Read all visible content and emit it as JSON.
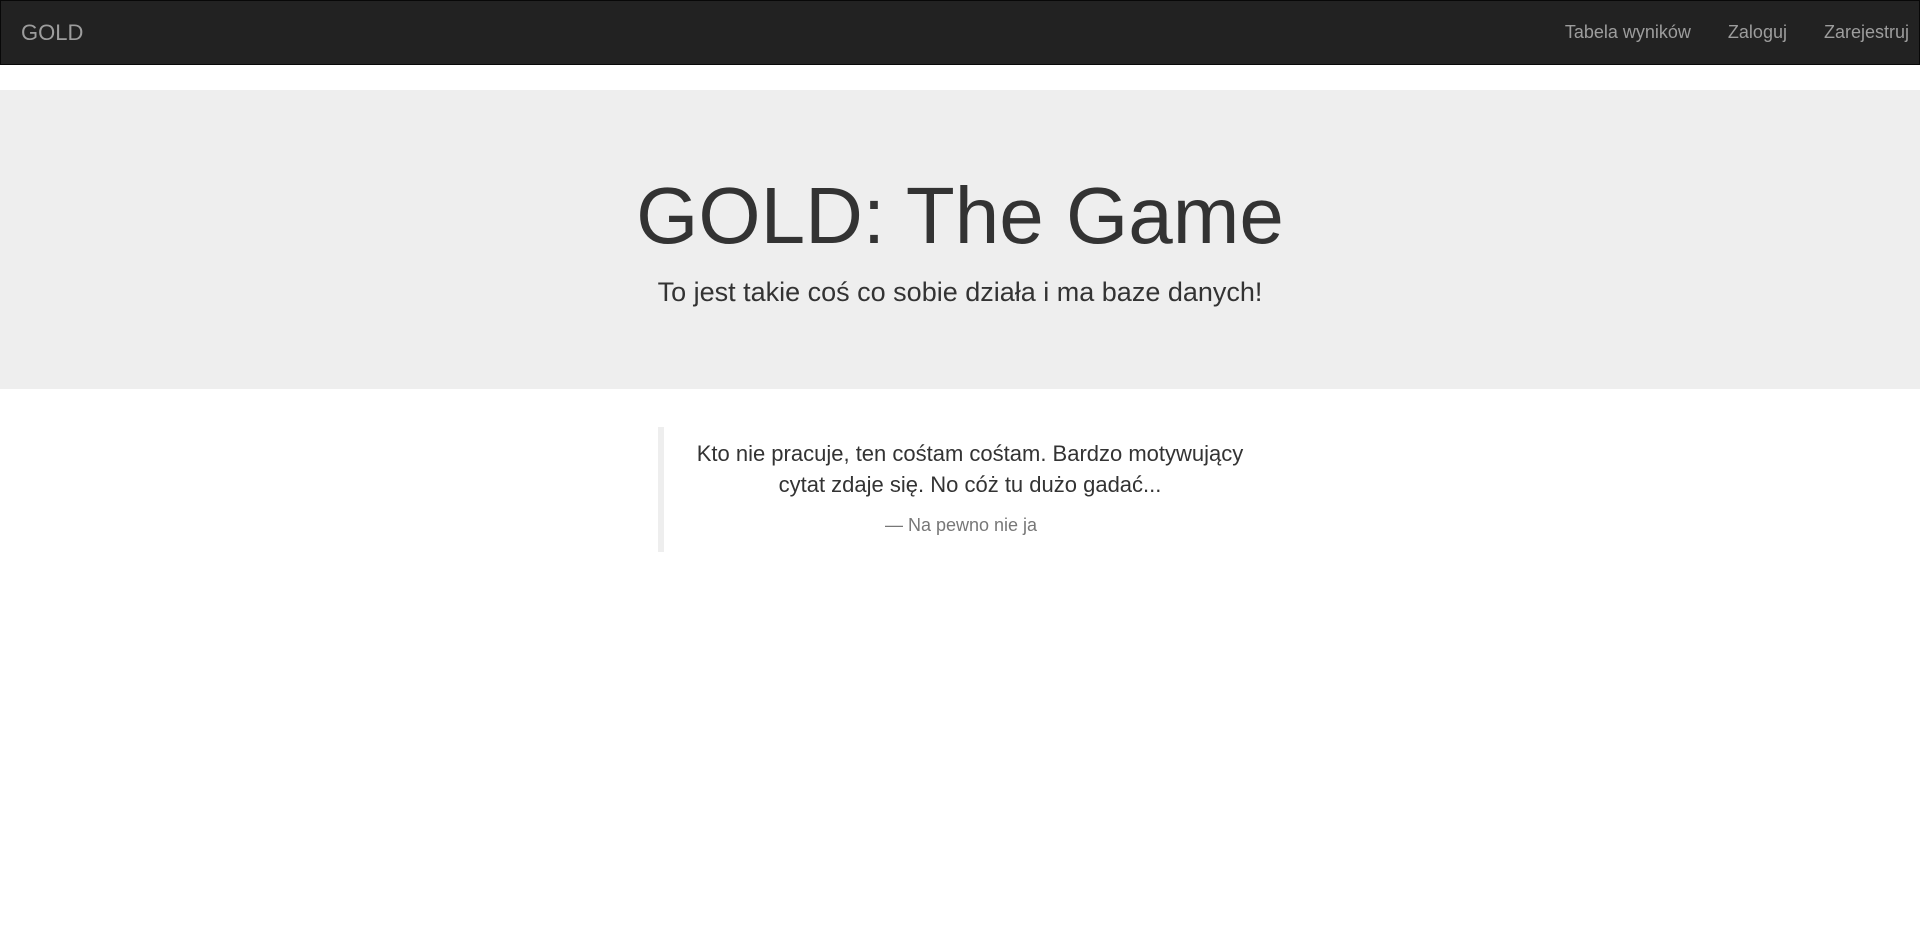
{
  "navbar": {
    "brand": "GOLD",
    "links": [
      {
        "label": "Tabela wyników"
      },
      {
        "label": "Zaloguj"
      },
      {
        "label": "Zarejestruj"
      }
    ]
  },
  "jumbotron": {
    "title": "GOLD: The Game",
    "subtitle": "To jest takie coś co sobie działa i ma baze danych!"
  },
  "quote": {
    "text": "Kto nie pracuje, ten cośtam cośtam. Bardzo motywujący cytat zdaje się. No cóż tu dużo gadać...",
    "author": "— Na pewno nie ja"
  },
  "colors": {
    "navbar_bg": "#222222",
    "nav_text": "#9d9d9d",
    "jumbotron_bg": "#eeeeee",
    "text": "#333333",
    "muted": "#777777"
  }
}
